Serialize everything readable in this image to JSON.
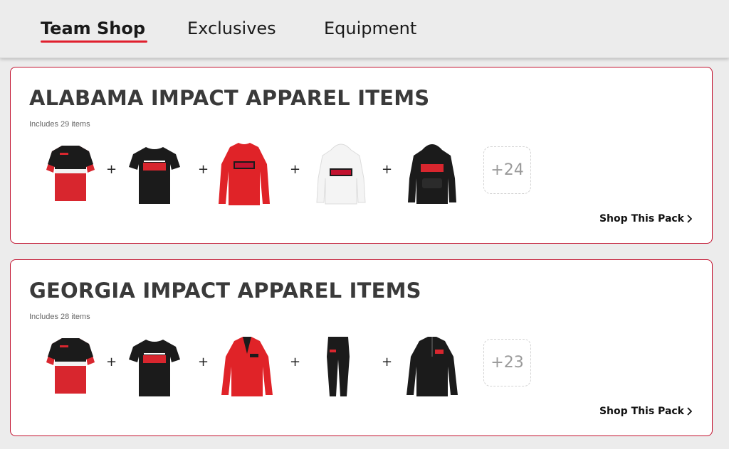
{
  "nav": {
    "tabs": [
      {
        "label": "Team Shop",
        "active": true
      },
      {
        "label": "Exclusives",
        "active": false
      },
      {
        "label": "Equipment",
        "active": false
      }
    ]
  },
  "colors": {
    "accent": "#e0202e",
    "border": "#c2122f",
    "black": "#1b1b1b",
    "red": "#d8262e"
  },
  "packs": [
    {
      "title": "ALABAMA IMPACT APPAREL ITEMS",
      "count_text": "Includes 29 items",
      "items": [
        "red-black-jersey-icon",
        "black-tshirt-icon",
        "red-long-sleeve-icon",
        "white-hoodie-icon",
        "black-hoodie-icon"
      ],
      "more": "+24",
      "cta": "Shop This Pack"
    },
    {
      "title": "GEORGIA IMPACT APPAREL ITEMS",
      "count_text": "Includes 28 items",
      "items": [
        "red-black-jersey-icon",
        "black-tshirt-icon",
        "red-pullover-icon",
        "black-joggers-icon",
        "black-quarter-zip-icon"
      ],
      "more": "+23",
      "cta": "Shop This Pack"
    }
  ]
}
